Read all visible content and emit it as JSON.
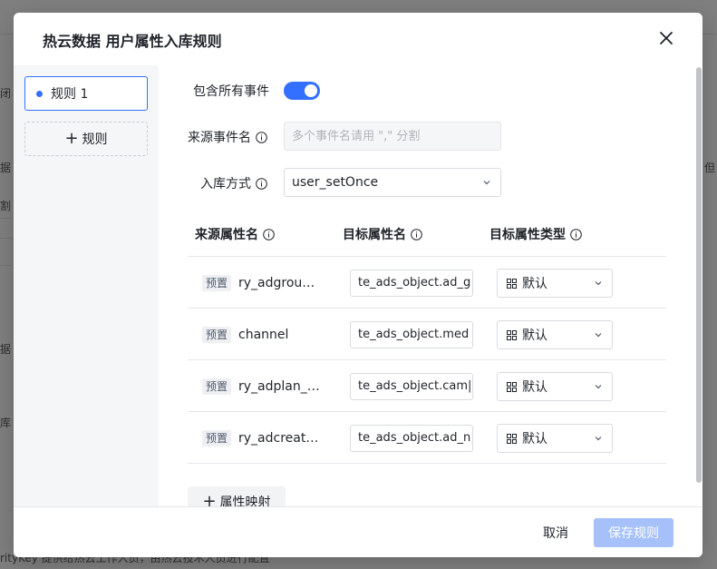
{
  "background": {
    "fragments": [
      "闭",
      "据",
      "割",
      "据",
      "库",
      "但",
      "rityKey 提供给热云工作人员，由热云技术人员进行配置"
    ]
  },
  "modal": {
    "title": "热云数据 用户属性入库规则",
    "close_icon": "close-icon"
  },
  "sidebar": {
    "rules": [
      {
        "label": "规则 1",
        "active": true
      }
    ],
    "add_rule_label": "规则"
  },
  "form": {
    "include_all_events_label": "包含所有事件",
    "include_all_events_on": true,
    "source_event_label": "来源事件名",
    "source_event_placeholder": "多个事件名请用 \",\" 分割",
    "storage_method_label": "入库方式",
    "storage_method_value": "user_setOnce"
  },
  "table": {
    "headers": [
      "来源属性名",
      "目标属性名",
      "目标属性类型"
    ],
    "rows": [
      {
        "tag": "预置",
        "source": "ry_adgroup_...",
        "target": "te_ads_object.ad_g",
        "type": "默认"
      },
      {
        "tag": "预置",
        "source": "channel",
        "target": "te_ads_object.med",
        "type": "默认"
      },
      {
        "tag": "预置",
        "source": "ry_adplan_n...",
        "target": "te_ads_object.cam|",
        "type": "默认"
      },
      {
        "tag": "预置",
        "source": "ry_adcreativ...",
        "target": "te_ads_object.ad_n",
        "type": "默认"
      }
    ],
    "add_mapping_label": "属性映射"
  },
  "footer": {
    "cancel_label": "取消",
    "save_label": "保存规则"
  },
  "colors": {
    "accent": "#3370ff",
    "save_disabled": "#a6c1f9"
  }
}
